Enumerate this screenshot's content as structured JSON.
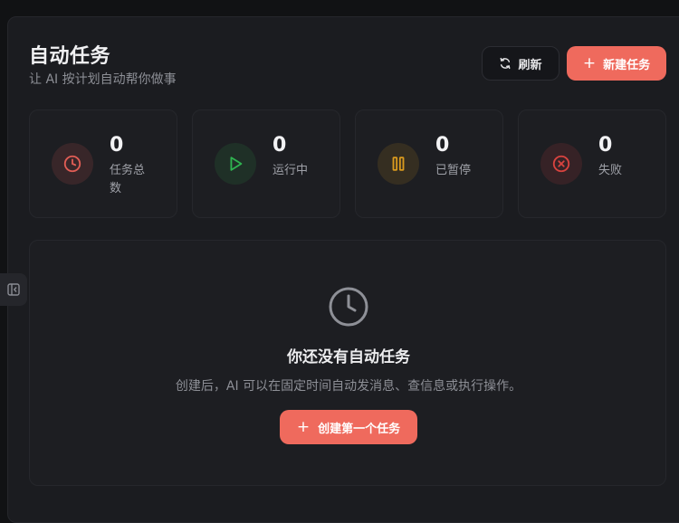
{
  "header": {
    "title": "自动任务",
    "subtitle": "让 AI 按计划自动帮你做事",
    "refresh_label": "刷新",
    "new_task_label": "新建任务"
  },
  "stats": [
    {
      "value": "0",
      "label": "任务总数",
      "icon": "clock-icon",
      "color": "#e05d55"
    },
    {
      "value": "0",
      "label": "运行中",
      "icon": "play-icon",
      "color": "#2fb350"
    },
    {
      "value": "0",
      "label": "已暂停",
      "icon": "pause-icon",
      "color": "#d99a1e"
    },
    {
      "value": "0",
      "label": "失败",
      "icon": "x-circle-icon",
      "color": "#d8433f"
    }
  ],
  "empty_state": {
    "icon": "clock-icon",
    "title": "你还没有自动任务",
    "description": "创建后，AI 可以在固定时间自动发消息、查信息或执行操作。",
    "create_label": "创建第一个任务"
  },
  "colors": {
    "accent": "#ef6a5d",
    "background": "#1b1c20",
    "card": "#1d1e22"
  }
}
